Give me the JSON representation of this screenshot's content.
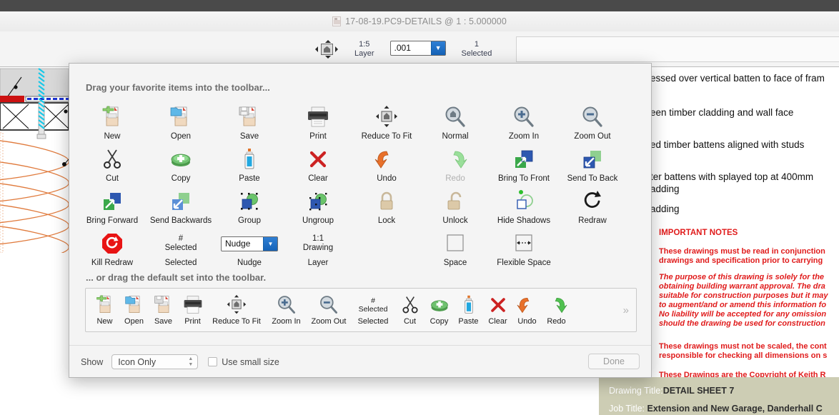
{
  "window": {
    "title": "17-08-19.PC9-DETAILS @ 1 : 5.000000",
    "doc_icon": "document-icon"
  },
  "app_toolbar": {
    "reduce_to_fit_icon": "reduce-to-fit-icon",
    "layer_scale": "1:5",
    "layer_label": "Layer",
    "nudge_value": ".001",
    "selected_count": "1",
    "selected_label": "Selected"
  },
  "customize_sheet": {
    "heading": "Drag your favorite items into the toolbar...",
    "subheading": "... or drag the default set into the toolbar.",
    "palette": [
      [
        {
          "label": "New",
          "icon": "new-document-icon",
          "dim": false
        },
        {
          "label": "Open",
          "icon": "open-folder-icon",
          "dim": false
        },
        {
          "label": "Save",
          "icon": "save-disk-icon",
          "dim": false
        },
        {
          "label": "Print",
          "icon": "printer-icon",
          "dim": false
        },
        {
          "label": "Reduce To Fit",
          "icon": "reduce-to-fit-icon",
          "dim": false
        },
        {
          "label": "Normal",
          "icon": "normal-magnifier-icon",
          "dim": false
        },
        {
          "label": "Zoom In",
          "icon": "zoom-in-icon",
          "dim": false
        },
        {
          "label": "Zoom Out",
          "icon": "zoom-out-icon",
          "dim": false
        }
      ],
      [
        {
          "label": "Cut",
          "icon": "scissors-icon",
          "dim": false
        },
        {
          "label": "Copy",
          "icon": "copy-icon",
          "dim": false
        },
        {
          "label": "Paste",
          "icon": "paste-glue-icon",
          "dim": false
        },
        {
          "label": "Clear",
          "icon": "clear-x-icon",
          "dim": false
        },
        {
          "label": "Undo",
          "icon": "undo-arrow-icon",
          "dim": false
        },
        {
          "label": "Redo",
          "icon": "redo-arrow-icon",
          "dim": true
        },
        {
          "label": "Bring To Front",
          "icon": "bring-to-front-icon",
          "dim": false
        },
        {
          "label": "Send To Back",
          "icon": "send-to-back-icon",
          "dim": false
        }
      ],
      [
        {
          "label": "Bring Forward",
          "icon": "bring-forward-icon",
          "dim": false
        },
        {
          "label": "Send Backwards",
          "icon": "send-backwards-icon",
          "dim": false
        },
        {
          "label": "Group",
          "icon": "group-icon",
          "dim": false
        },
        {
          "label": "Ungroup",
          "icon": "ungroup-icon",
          "dim": false
        },
        {
          "label": "Lock",
          "icon": "lock-icon",
          "dim": false
        },
        {
          "label": "Unlock",
          "icon": "unlock-icon",
          "dim": false
        },
        {
          "label": "Hide Shadows",
          "icon": "hide-shadows-icon",
          "dim": false
        },
        {
          "label": "Redraw",
          "icon": "redraw-icon",
          "dim": false
        }
      ],
      [
        {
          "label": "Kill Redraw",
          "icon": "kill-redraw-icon",
          "dim": false
        },
        {
          "label": "Selected",
          "icon": "selected-count-icon",
          "dim": false,
          "glyph_l1": "#",
          "glyph_l2": "Selected"
        },
        {
          "label": "Nudge",
          "icon": "nudge-combo-icon",
          "dim": false,
          "combo_value": "Nudge"
        },
        {
          "label": "Layer",
          "icon": "layer-scale-icon",
          "dim": false,
          "glyph_l1": "1:1",
          "glyph_l2": "Drawing"
        },
        {
          "label": "",
          "icon": "",
          "dim": false
        },
        {
          "label": "Space",
          "icon": "space-icon",
          "dim": false
        },
        {
          "label": "Flexible Space",
          "icon": "flexible-space-icon",
          "dim": false
        },
        {
          "label": "",
          "icon": "",
          "dim": false
        }
      ]
    ],
    "default_set": [
      {
        "label": "New",
        "icon": "new-document-icon"
      },
      {
        "label": "Open",
        "icon": "open-folder-icon"
      },
      {
        "label": "Save",
        "icon": "save-disk-icon"
      },
      {
        "label": "Print",
        "icon": "printer-icon"
      },
      {
        "label": "Reduce To Fit",
        "icon": "reduce-to-fit-icon"
      },
      {
        "label": "Zoom In",
        "icon": "zoom-in-icon"
      },
      {
        "label": "Zoom Out",
        "icon": "zoom-out-icon"
      },
      {
        "label": "Selected",
        "icon": "selected-count-icon",
        "glyph_l1": "#",
        "glyph_l2": "Selected"
      },
      {
        "label": "Cut",
        "icon": "scissors-icon"
      },
      {
        "label": "Copy",
        "icon": "copy-icon"
      },
      {
        "label": "Paste",
        "icon": "paste-glue-icon"
      },
      {
        "label": "Clear",
        "icon": "clear-x-icon"
      },
      {
        "label": "Undo",
        "icon": "undo-arrow-icon"
      },
      {
        "label": "Redo",
        "icon": "redo-arrow-icon"
      }
    ],
    "overflow_glyph": "»",
    "footer": {
      "show_label": "Show",
      "show_value": "Icon Only",
      "small_size_label": "Use small size",
      "done_label": "Done"
    }
  },
  "drawing": {
    "notes": [
      "essed over vertical batten to face of fram",
      "een timber cladding and wall face",
      "ed timber battens aligned with studs",
      "ter battens with splayed top at 400mm",
      "adding",
      "adding"
    ],
    "important_heading": "IMPORTANT NOTES",
    "red_blocks": [
      {
        "lines": [
          "These drawings must be read in conjunction",
          "drawings and specification prior to carrying"
        ],
        "italic": false
      },
      {
        "lines": [
          "The purpose of this drawing is solely for the",
          "obtaining building warrant approval. The dra",
          "suitable for construction purposes but it may",
          "to augment/and or amend this information fo",
          "No liability will be accepted for any omission",
          "should the drawing be used for construction"
        ],
        "italic": true
      },
      {
        "lines": [
          "These drawings must not be scaled, the cont",
          "responsible for checking all dimensions on s"
        ],
        "italic": false
      },
      {
        "lines": [
          "These Drawings are the Copyright of  Keith R"
        ],
        "italic": false
      }
    ],
    "title_block": {
      "drawing_title_label": "Drawing Title:",
      "drawing_title_value": "DETAIL SHEET 7",
      "job_title_label": "Job Title:",
      "job_title_value": "Extension and New Garage, Danderhall C"
    },
    "colors": {
      "red_note": "#e01b1b",
      "insulation": "#e07a3c",
      "title_block_bg": "#cdcdb4"
    }
  }
}
